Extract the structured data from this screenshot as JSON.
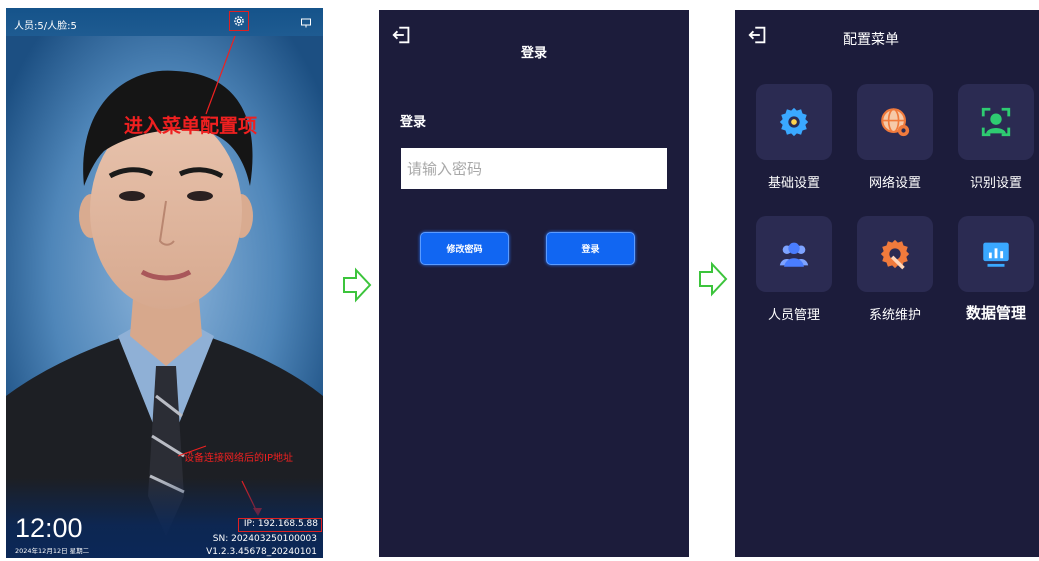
{
  "camera": {
    "top_info": "人员:5/人脸:5",
    "menu_hint": "进入菜单配置项",
    "ip_hint": "设备连接网络后的IP地址",
    "time": "12:00",
    "date": "2024年12月12日 星期二",
    "ip": "IP:  192.168.5.88",
    "sn": "SN:  202403250100003",
    "version": "V1.2.3.45678_20240101",
    "icons": {
      "settings": "gear-icon",
      "screen": "screen-icon"
    },
    "colors": {
      "highlight": "#e02020"
    }
  },
  "login": {
    "title": "登录",
    "section_label": "登录",
    "password_placeholder": "请输入密码",
    "change_password_label": "修改密码",
    "login_label": "登录",
    "colors": {
      "background": "#1c1c3b",
      "button": "#1166f2"
    }
  },
  "menu": {
    "title": "配置菜单",
    "items": [
      {
        "label": "基础设置",
        "icon": "gear-icon",
        "color": "#3aa8ff"
      },
      {
        "label": "网络设置",
        "icon": "globe-gear-icon",
        "color": "#f07a3c"
      },
      {
        "label": "识别设置",
        "icon": "face-scan-icon",
        "color": "#2ecc71"
      },
      {
        "label": "人员管理",
        "icon": "users-icon",
        "color": "#4a7dff"
      },
      {
        "label": "系统维护",
        "icon": "wrench-gear-icon",
        "color": "#f07a3c"
      },
      {
        "label": "数据管理",
        "icon": "chart-monitor-icon",
        "color": "#3aa8ff"
      }
    ]
  }
}
